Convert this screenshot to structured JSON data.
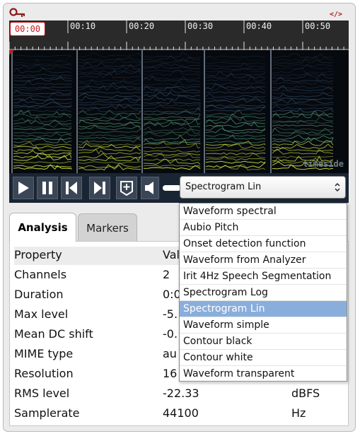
{
  "ruler": {
    "current_time": "00:00",
    "ticks": [
      "00:10",
      "00:20",
      "00:30",
      "00:40",
      "00:50"
    ]
  },
  "spectrogram": {
    "watermark": "timeside"
  },
  "controls": {
    "buttons": [
      "play-icon",
      "pause-icon",
      "skip-back-icon",
      "skip-forward-icon",
      "add-marker-icon",
      "volume-icon"
    ],
    "select_value": "Spectrogram Lin"
  },
  "dropdown": {
    "options": [
      "Waveform spectral",
      "Aubio Pitch",
      "Onset detection function",
      "Waveform from Analyzer",
      "Irit 4Hz Speech Segmentation",
      "Spectrogram Log",
      "Spectrogram Lin",
      "Waveform simple",
      "Contour black",
      "Contour white",
      "Waveform transparent"
    ],
    "selected_index": 6
  },
  "tabs": {
    "analysis": "Analysis",
    "markers": "Markers"
  },
  "table": {
    "headers": {
      "property": "Property",
      "value": "Val"
    },
    "rows": [
      {
        "property": "Channels",
        "value": "2",
        "unit": ""
      },
      {
        "property": "Duration",
        "value": "0:0",
        "unit": ""
      },
      {
        "property": "Max level",
        "value": "-5.",
        "unit": ""
      },
      {
        "property": "Mean DC shift",
        "value": "-0.",
        "unit": ""
      },
      {
        "property": "MIME type",
        "value": "au",
        "unit": ""
      },
      {
        "property": "Resolution",
        "value": "16",
        "unit": ""
      },
      {
        "property": "RMS level",
        "value": "-22.33",
        "unit": "dBFS"
      },
      {
        "property": "Samplerate",
        "value": "44100",
        "unit": "Hz"
      }
    ]
  },
  "colors": {
    "accent_red": "#c8171d",
    "selected_option": "#8aaedc",
    "control_bar": "#1a2533"
  }
}
